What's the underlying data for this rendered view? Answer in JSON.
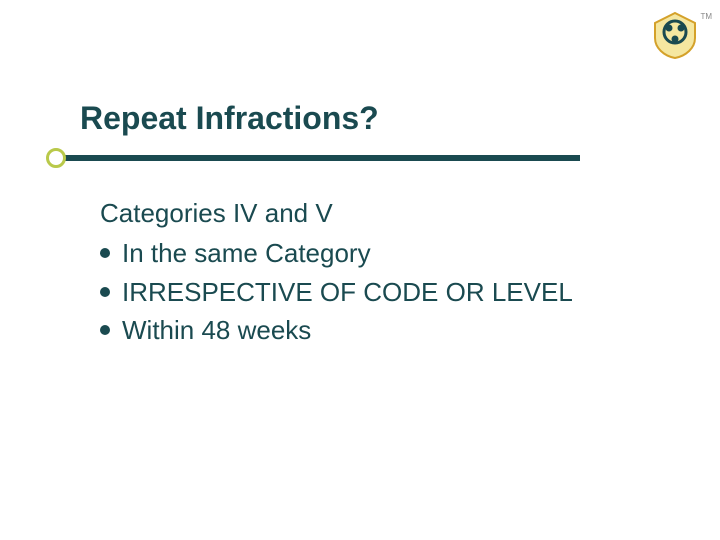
{
  "slide": {
    "title": "Repeat Infractions?",
    "intro": "Categories IV and V",
    "bullets": [
      "In the same Category",
      "IRRESPECTIVE OF CODE OR LEVEL",
      "Within 48 weeks"
    ],
    "logo_tm": "TM"
  },
  "colors": {
    "heading": "#1a4a50",
    "accent_green": "#b9c94a",
    "logo_gold": "#d4a12a"
  }
}
